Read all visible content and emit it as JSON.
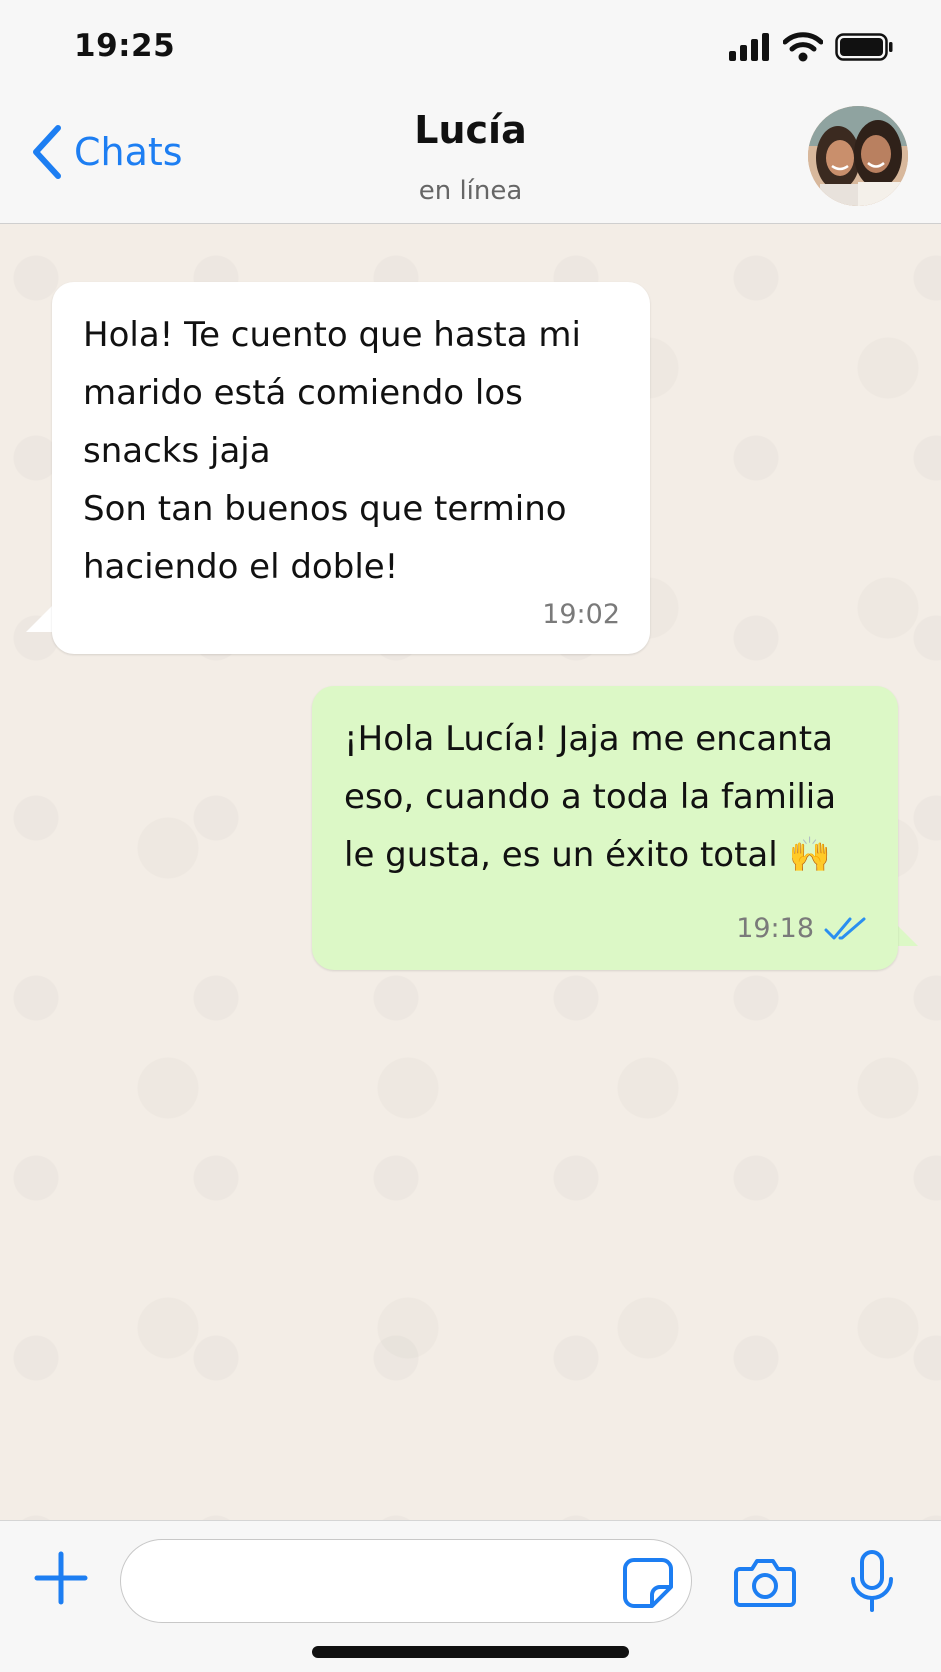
{
  "status_bar": {
    "time": "19:25",
    "icons": [
      "signal-icon",
      "wifi-icon",
      "battery-icon"
    ]
  },
  "header": {
    "back_label": "Chats",
    "contact_name": "Lucía",
    "contact_status": "en línea",
    "back_icon": "chevron-left-icon",
    "accent_color": "#1d7ef2"
  },
  "messages": [
    {
      "direction": "incoming",
      "lines": [
        "Hola! Te cuento que hasta mi",
        "marido está comiendo los",
        "snacks jaja",
        "Son tan buenos que termino",
        "haciendo el doble!"
      ],
      "time": "19:02",
      "bubble_color": "#ffffff"
    },
    {
      "direction": "outgoing",
      "lines": [
        "¡Hola Lucía! Jaja me encanta",
        "eso, cuando a toda la familia",
        "le gusta, es un éxito total 🙌"
      ],
      "time": "19:18",
      "status_icon": "double-check-icon",
      "bubble_color": "#dcf8c6"
    }
  ],
  "input_bar": {
    "placeholder": "",
    "icons": [
      "plus-icon",
      "sticker-icon",
      "camera-icon",
      "microphone-icon"
    ]
  }
}
